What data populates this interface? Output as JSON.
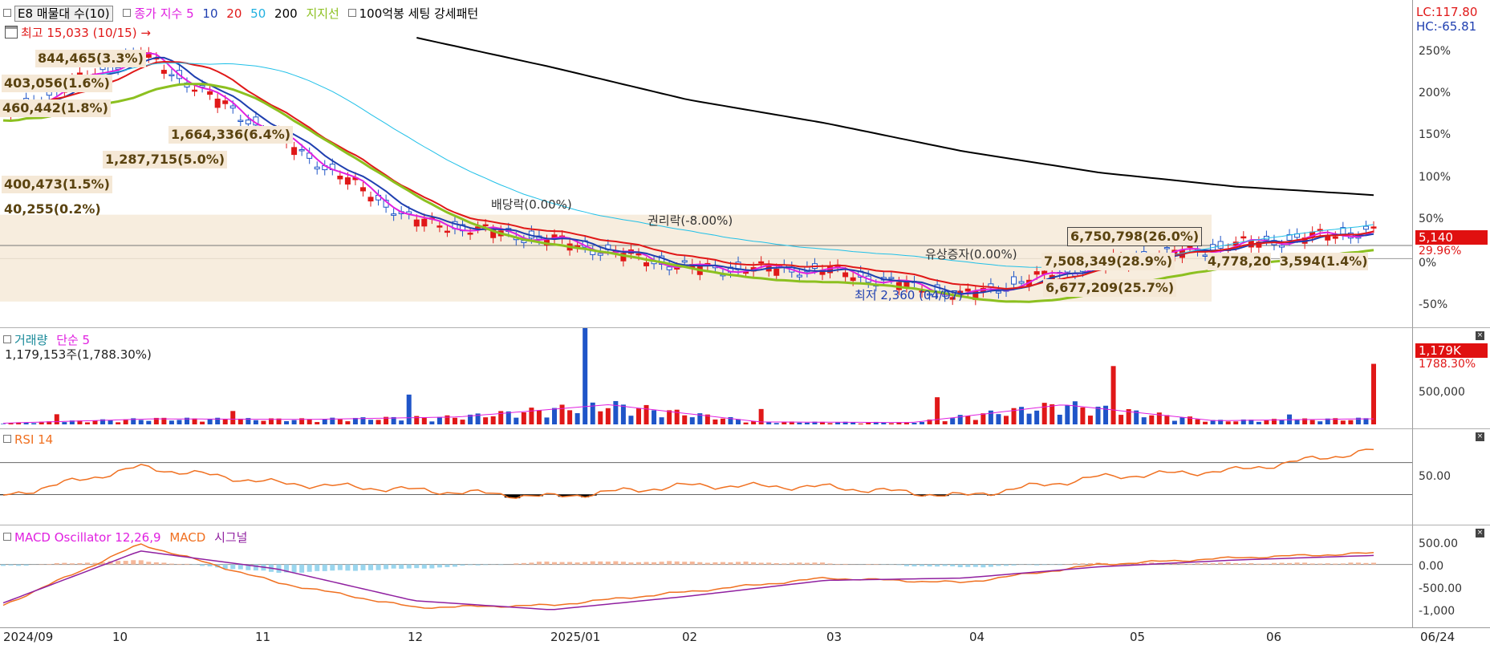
{
  "legend": {
    "ticker": "E8 매물대 수(10)",
    "price_label": "종가 지수 5",
    "ma10": "10",
    "ma20": "20",
    "ma50": "50",
    "ma200": "200",
    "lagging": "지지선",
    "setting": "100억봉 세팅 강세패턴"
  },
  "high_label": "최고 15,033 (10/15)",
  "low_label": "최저 2,360 (04/07)",
  "lc_label": "LC:117.80",
  "hc_label": "HC:-65.81",
  "events": [
    "배당락(0.00%)",
    "권리락(-8.00%)",
    "유상증자(0.00%)"
  ],
  "volume_profile": [
    "844,465(3.3%)",
    "403,056(1.6%)",
    "460,442(1.8%)",
    "1,664,336(6.4%)",
    "1,287,715(5.0%)",
    "400,473(1.5%)",
    "40,255(0.2%)",
    "6,750,798(26.0%)",
    "7,508,349(28.9%)",
    "4,778,20",
    "3,594(1.4%)",
    "6,677,209(25.7%)"
  ],
  "price_axis": [
    "250%",
    "200%",
    "150%",
    "100%",
    "50%",
    "0%",
    "-50%"
  ],
  "price_tag": "5,140",
  "price_pct": "29.96%",
  "volume_pane": {
    "title": "거래량",
    "ma": "단순 5",
    "value": "1,179,153주(1,788.30%)",
    "axis": "500,000",
    "tag": "1,179K",
    "tag_pct": "1788.30%"
  },
  "rsi_pane": {
    "title": "RSI 14",
    "axis": "50.00"
  },
  "macd_pane": {
    "title": "MACD Oscillator 12,26,9",
    "macd": "MACD",
    "signal": "시그널",
    "axis": [
      "500.00",
      "0.00",
      "-500.00",
      "-1,000"
    ]
  },
  "x_axis": [
    "2024/09",
    "10",
    "11",
    "12",
    "2025/01",
    "02",
    "03",
    "04",
    "05",
    "06",
    "06/24"
  ],
  "colors": {
    "up": "#e01818",
    "down": "#1f55c8",
    "ma5": "#e020e0",
    "ma10": "#1f3fb0",
    "ma20": "#e01818",
    "ma50": "#20c0e8",
    "ma200": "#000000",
    "support": "#8cc020",
    "rsi": "#f07020",
    "macd": "#f07020",
    "signal": "#9020a0"
  },
  "chart_data": [
    {
      "type": "line",
      "title": "E8 매물대 수(10)",
      "x": [
        "2024/09",
        "10",
        "11",
        "12",
        "2025/01",
        "02",
        "03",
        "04",
        "05",
        "06",
        "06/24"
      ],
      "series": [
        {
          "name": "종가 지수 5",
          "values": [
            155,
            220,
            130,
            40,
            20,
            -10,
            -12,
            -40,
            -5,
            15,
            30
          ]
        },
        {
          "name": "200",
          "values": [
            null,
            null,
            null,
            237,
            205,
            170,
            145,
            115,
            92,
            77,
            68
          ]
        }
      ],
      "ylim": [
        -65,
        270
      ],
      "ylabel": "%"
    },
    {
      "type": "bar",
      "title": "거래량",
      "x": [
        "2024/09",
        "10",
        "11",
        "12",
        "2025/01",
        "02",
        "03",
        "04",
        "05",
        "06",
        "06/24"
      ],
      "series": [
        {
          "name": "거래량",
          "values": [
            20000,
            90000,
            80000,
            120000,
            320000,
            40000,
            30000,
            320000,
            60000,
            90000,
            1179153
          ]
        }
      ]
    },
    {
      "type": "line",
      "title": "RSI 14",
      "x": [
        "2024/09",
        "10",
        "11",
        "12",
        "2025/01",
        "02",
        "03",
        "04",
        "05",
        "06",
        "06/24"
      ],
      "series": [
        {
          "name": "RSI 14",
          "values": [
            28,
            66,
            45,
            36,
            27,
            42,
            40,
            28,
            53,
            62,
            88
          ]
        }
      ],
      "ylim": [
        0,
        100
      ]
    },
    {
      "type": "line",
      "title": "MACD Oscillator 12,26,9",
      "x": [
        "2024/09",
        "10",
        "11",
        "12",
        "2025/01",
        "02",
        "03",
        "04",
        "05",
        "06",
        "06/24"
      ],
      "series": [
        {
          "name": "MACD",
          "values": [
            -900,
            450,
            -400,
            -950,
            -900,
            -600,
            -300,
            -400,
            0,
            150,
            250
          ]
        },
        {
          "name": "시그널",
          "values": [
            -850,
            300,
            -100,
            -800,
            -1000,
            -700,
            -350,
            -300,
            -50,
            100,
            200
          ]
        }
      ],
      "ylim": [
        -1300,
        650
      ]
    }
  ]
}
